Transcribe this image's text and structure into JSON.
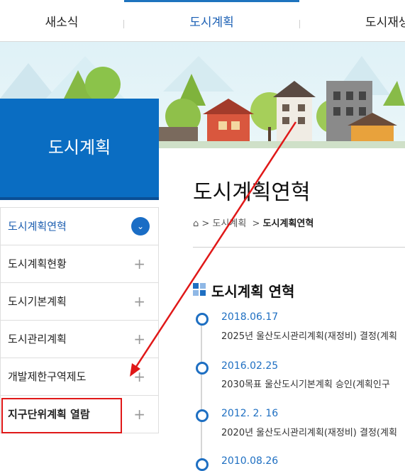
{
  "topnav": {
    "tabs": [
      "새소식",
      "도시계획",
      "도시재생"
    ],
    "active": 1
  },
  "section_title": "도시계획",
  "sidebar": {
    "items": [
      {
        "label": "도시계획연혁",
        "active": true
      },
      {
        "label": "도시계획현황"
      },
      {
        "label": "도시기본계획"
      },
      {
        "label": "도시관리계획"
      },
      {
        "label": "개발제한구역제도"
      },
      {
        "label": "지구단위계획 열람"
      }
    ]
  },
  "page": {
    "title": "도시계획연혁",
    "breadcrumb": [
      "도시계획",
      "도시계획연혁"
    ],
    "section_heading": "도시계획 연혁",
    "timeline": [
      {
        "date": "2018.06.17",
        "desc": "2025년 울산도시관리계획(재정비) 결정(계획"
      },
      {
        "date": "2016.02.25",
        "desc": "2030목표 울산도시기본계획 승인(계획인구"
      },
      {
        "date": "2012. 2. 16",
        "desc": "2020년 울산도시관리계획(재정비) 결정(계획"
      },
      {
        "date": "2010.08.26",
        "desc": ""
      }
    ]
  },
  "colors": {
    "primary": "#1e6fc2",
    "panel": "#0a6dc2",
    "highlight": "#e01818"
  }
}
